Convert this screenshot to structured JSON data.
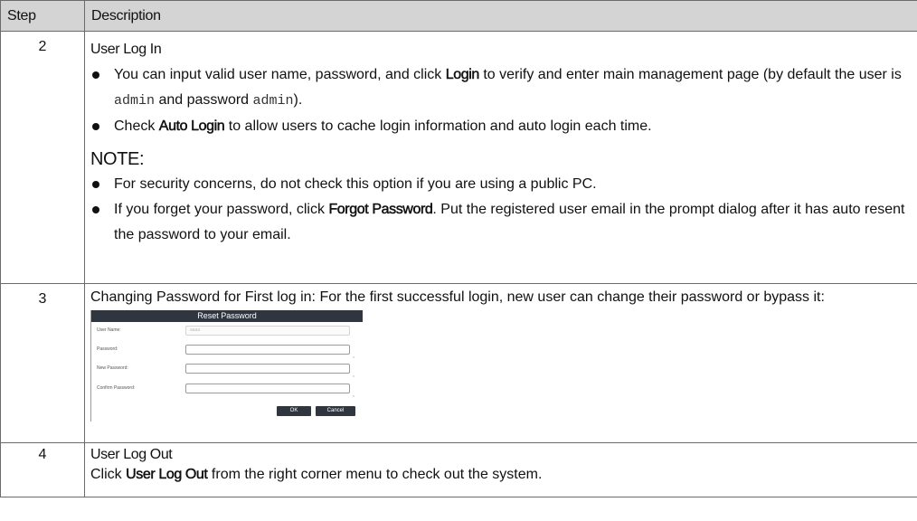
{
  "table": {
    "headers": {
      "step": "Step",
      "description": "Description"
    },
    "rows": [
      {
        "step": "2",
        "title": "User Log In",
        "bullets": [
          {
            "pre": "You can input valid user name, password, and click ",
            "bold": "Login",
            "mid": " to verify and enter main management page (by default the user is ",
            "code1": "admin",
            "and": " and password ",
            "code2": "admin",
            "post": ")."
          },
          {
            "pre": "Check ",
            "bold": "Auto Login",
            "post": " to allow users to cache login information and auto login each time."
          }
        ],
        "note_label": "NOTE:",
        "note_bullets": [
          {
            "text": "For security concerns, do not check this option if you are using a public PC."
          },
          {
            "pre": "If you forget your password, click ",
            "bold": "Forgot Password",
            "post": ". Put the registered user email in the prompt dialog after it has auto resent the password to your email."
          }
        ]
      },
      {
        "step": "3",
        "text": "Changing Password for First log in: For the first successful login, new user can change their password or bypass it:",
        "dialog": {
          "title": "Reset Password",
          "fields": [
            {
              "label": "User Name:",
              "value": "aaaa"
            },
            {
              "label": "Password:",
              "value": ""
            },
            {
              "label": "New Password:",
              "value": ""
            },
            {
              "label": "Confirm Password:",
              "value": ""
            }
          ],
          "required_mark": "*",
          "ok_label": "OK",
          "cancel_label": "Cancel"
        }
      },
      {
        "step": "4",
        "title": "User Log Out",
        "pre": "Click ",
        "bold": "User Log Out",
        "post": " from the right corner menu to check out the system."
      }
    ]
  }
}
